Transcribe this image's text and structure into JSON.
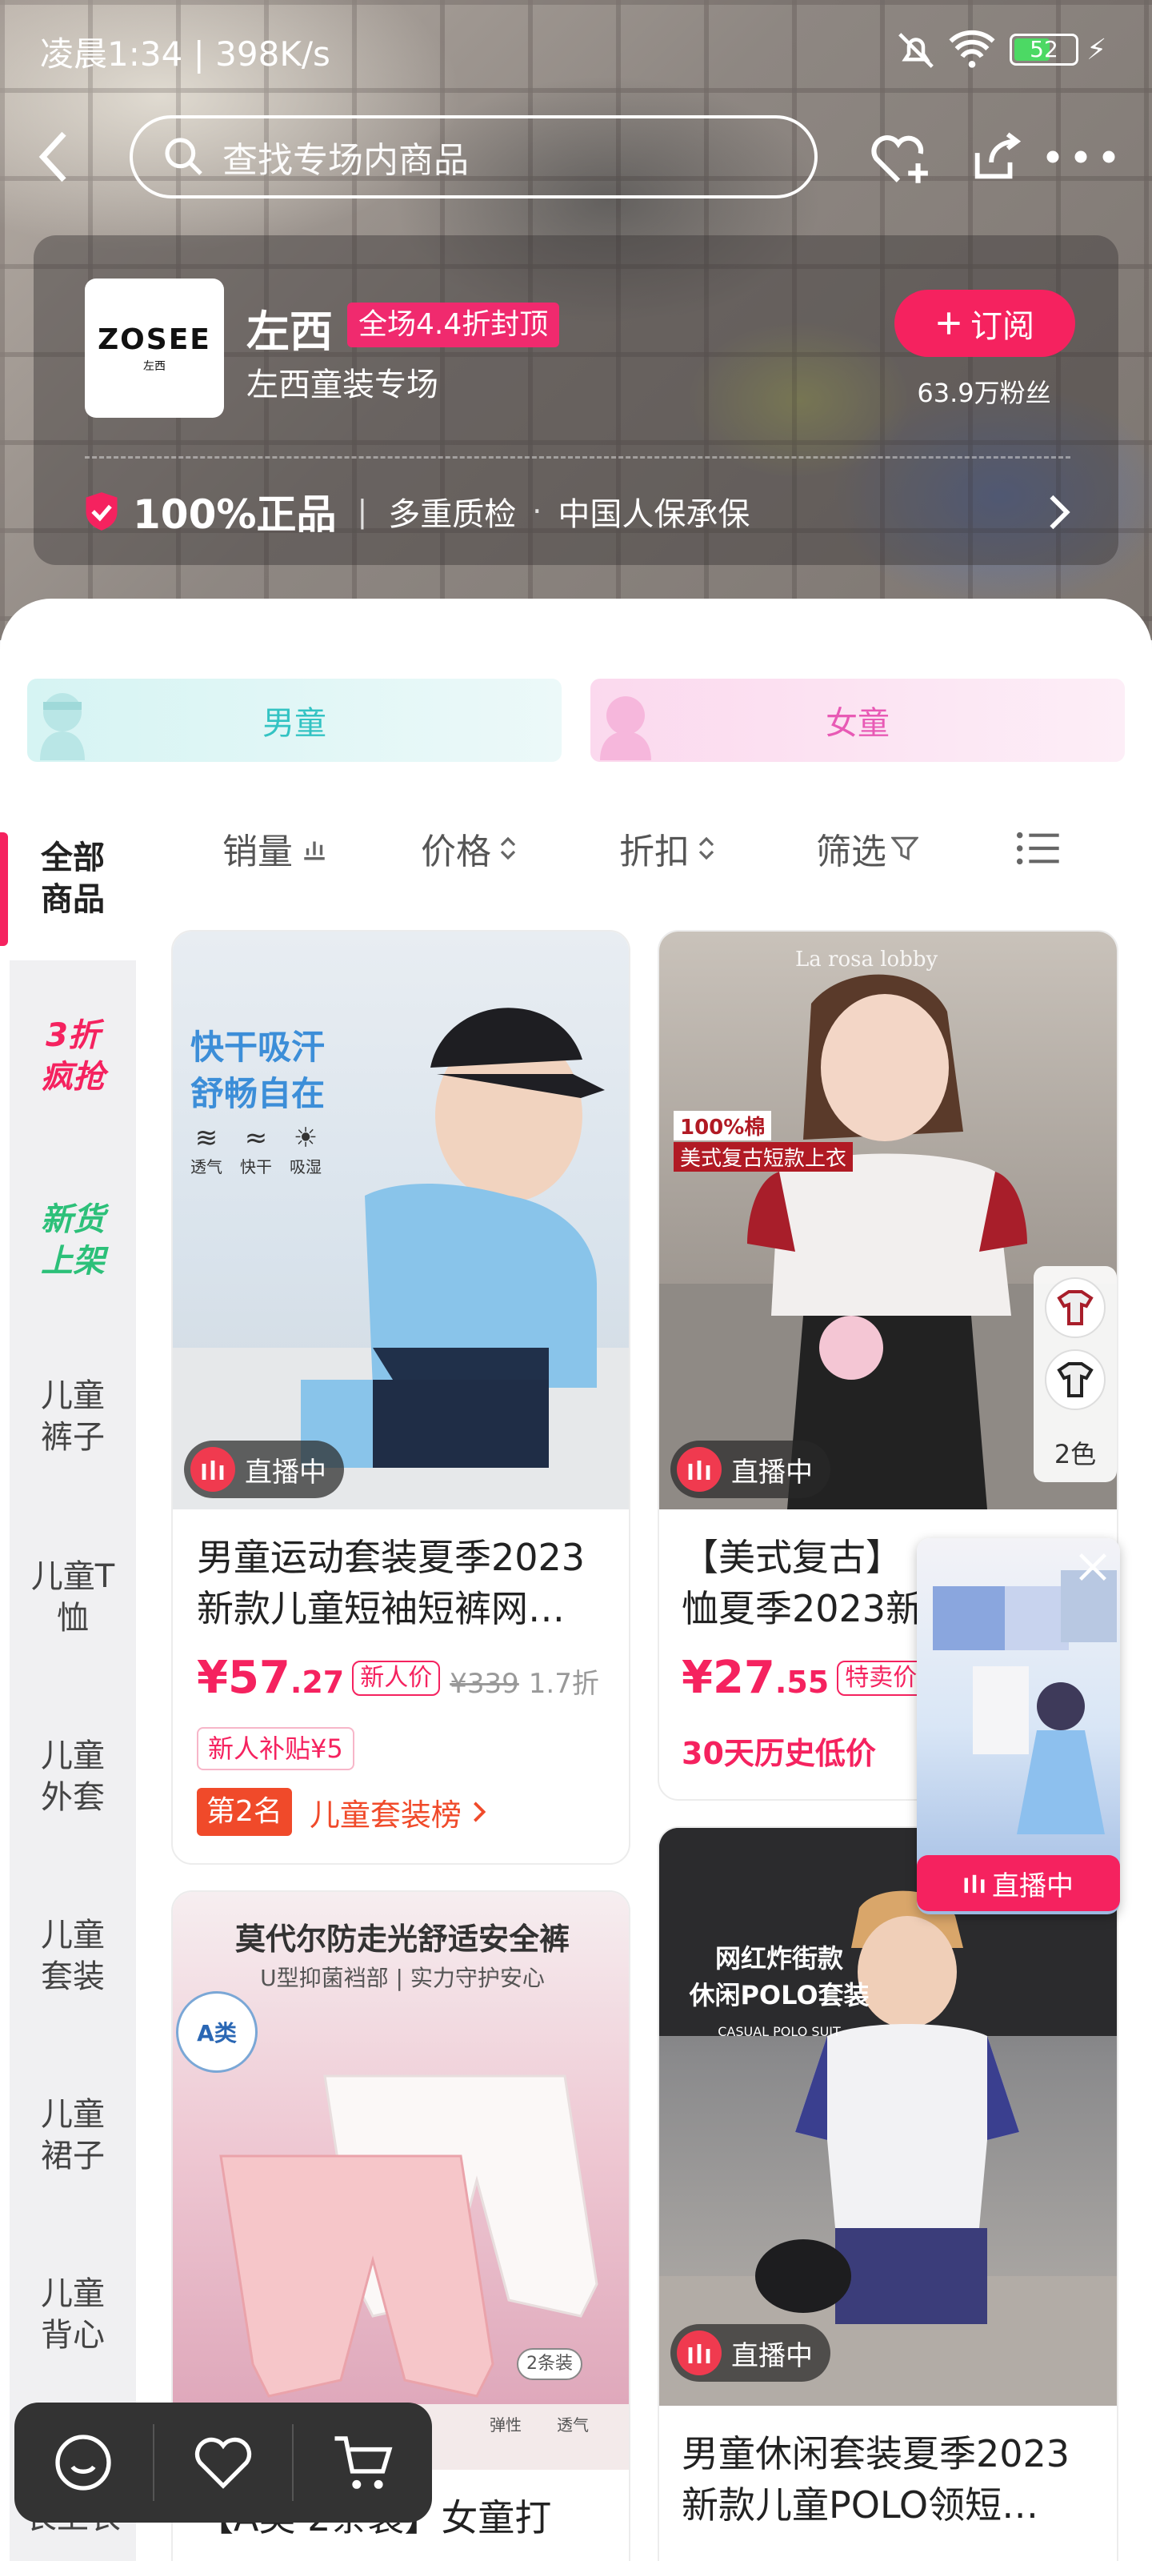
{
  "status_bar": {
    "time_speed": "凌晨1:34 | 398K/s",
    "battery": "52"
  },
  "search": {
    "placeholder": "查找专场内商品"
  },
  "brand": {
    "logo_text": "ZOSEE",
    "logo_sub": "左西",
    "name": "左西",
    "promo_tag": "全场4.4折封顶",
    "subtitle": "左西童装专场",
    "subscribe_label": "订阅",
    "fans": "63.9万粉丝",
    "guarantee_main": "100%正品",
    "guarantee_items": [
      "多重质检",
      "中国人保承保"
    ]
  },
  "gender_tabs": [
    "男童",
    "女童"
  ],
  "sidebar": {
    "items": [
      "全部\n商品",
      "3折\n疯抢",
      "新货\n上架",
      "儿童\n裤子",
      "儿童T\n恤",
      "儿童\n外套",
      "儿童\n套装",
      "儿童\n裙子",
      "儿童\n背心",
      "长上衣"
    ]
  },
  "sort_bar": {
    "items": [
      "销量",
      "价格",
      "折扣",
      "筛选"
    ]
  },
  "products": [
    {
      "title": "男童运动套装夏季2023新款儿童短袖短裤网…",
      "live": "直播中",
      "price_int": "¥57",
      "price_dec": ".27",
      "price_tag": "新人价",
      "orig_price": "¥339",
      "discount": "1.7折",
      "subsidy": "新人补贴¥5",
      "rank_badge": "第2名",
      "rank_text": "儿童套装榜",
      "img_text": [
        "快干吸汗",
        "舒畅自在"
      ],
      "img_icons": [
        "透气",
        "快干",
        "吸湿"
      ]
    },
    {
      "title": "【美式复古】…恤夏季2023新…",
      "title_line1": "【美式复古】",
      "title_line2": "恤夏季2023新",
      "live": "直播中",
      "price_int": "¥27",
      "price_dec": ".55",
      "price_tag": "特卖价",
      "low_note": "30天历史低价",
      "img_text": [
        "100%棉",
        "美式复古短款上衣"
      ],
      "brand_watermark": "La rosa lobby",
      "colors": "2色"
    },
    {
      "title_line1": "【A类 2条装】女童打",
      "img_text": [
        "莫代尔防走光舒适安全裤",
        "U型抑菌裆部 | 实力守护安心",
        "A类",
        "2条装",
        "弹性",
        "透气"
      ]
    },
    {
      "title": "男童休闲套装夏季2023新款儿童POLO领短…",
      "live": "直播中",
      "img_text": [
        "网红炸街款",
        "休闲POLO套装",
        "CASUAL POLO SUIT"
      ]
    }
  ],
  "float_live": {
    "label": "直播中"
  }
}
